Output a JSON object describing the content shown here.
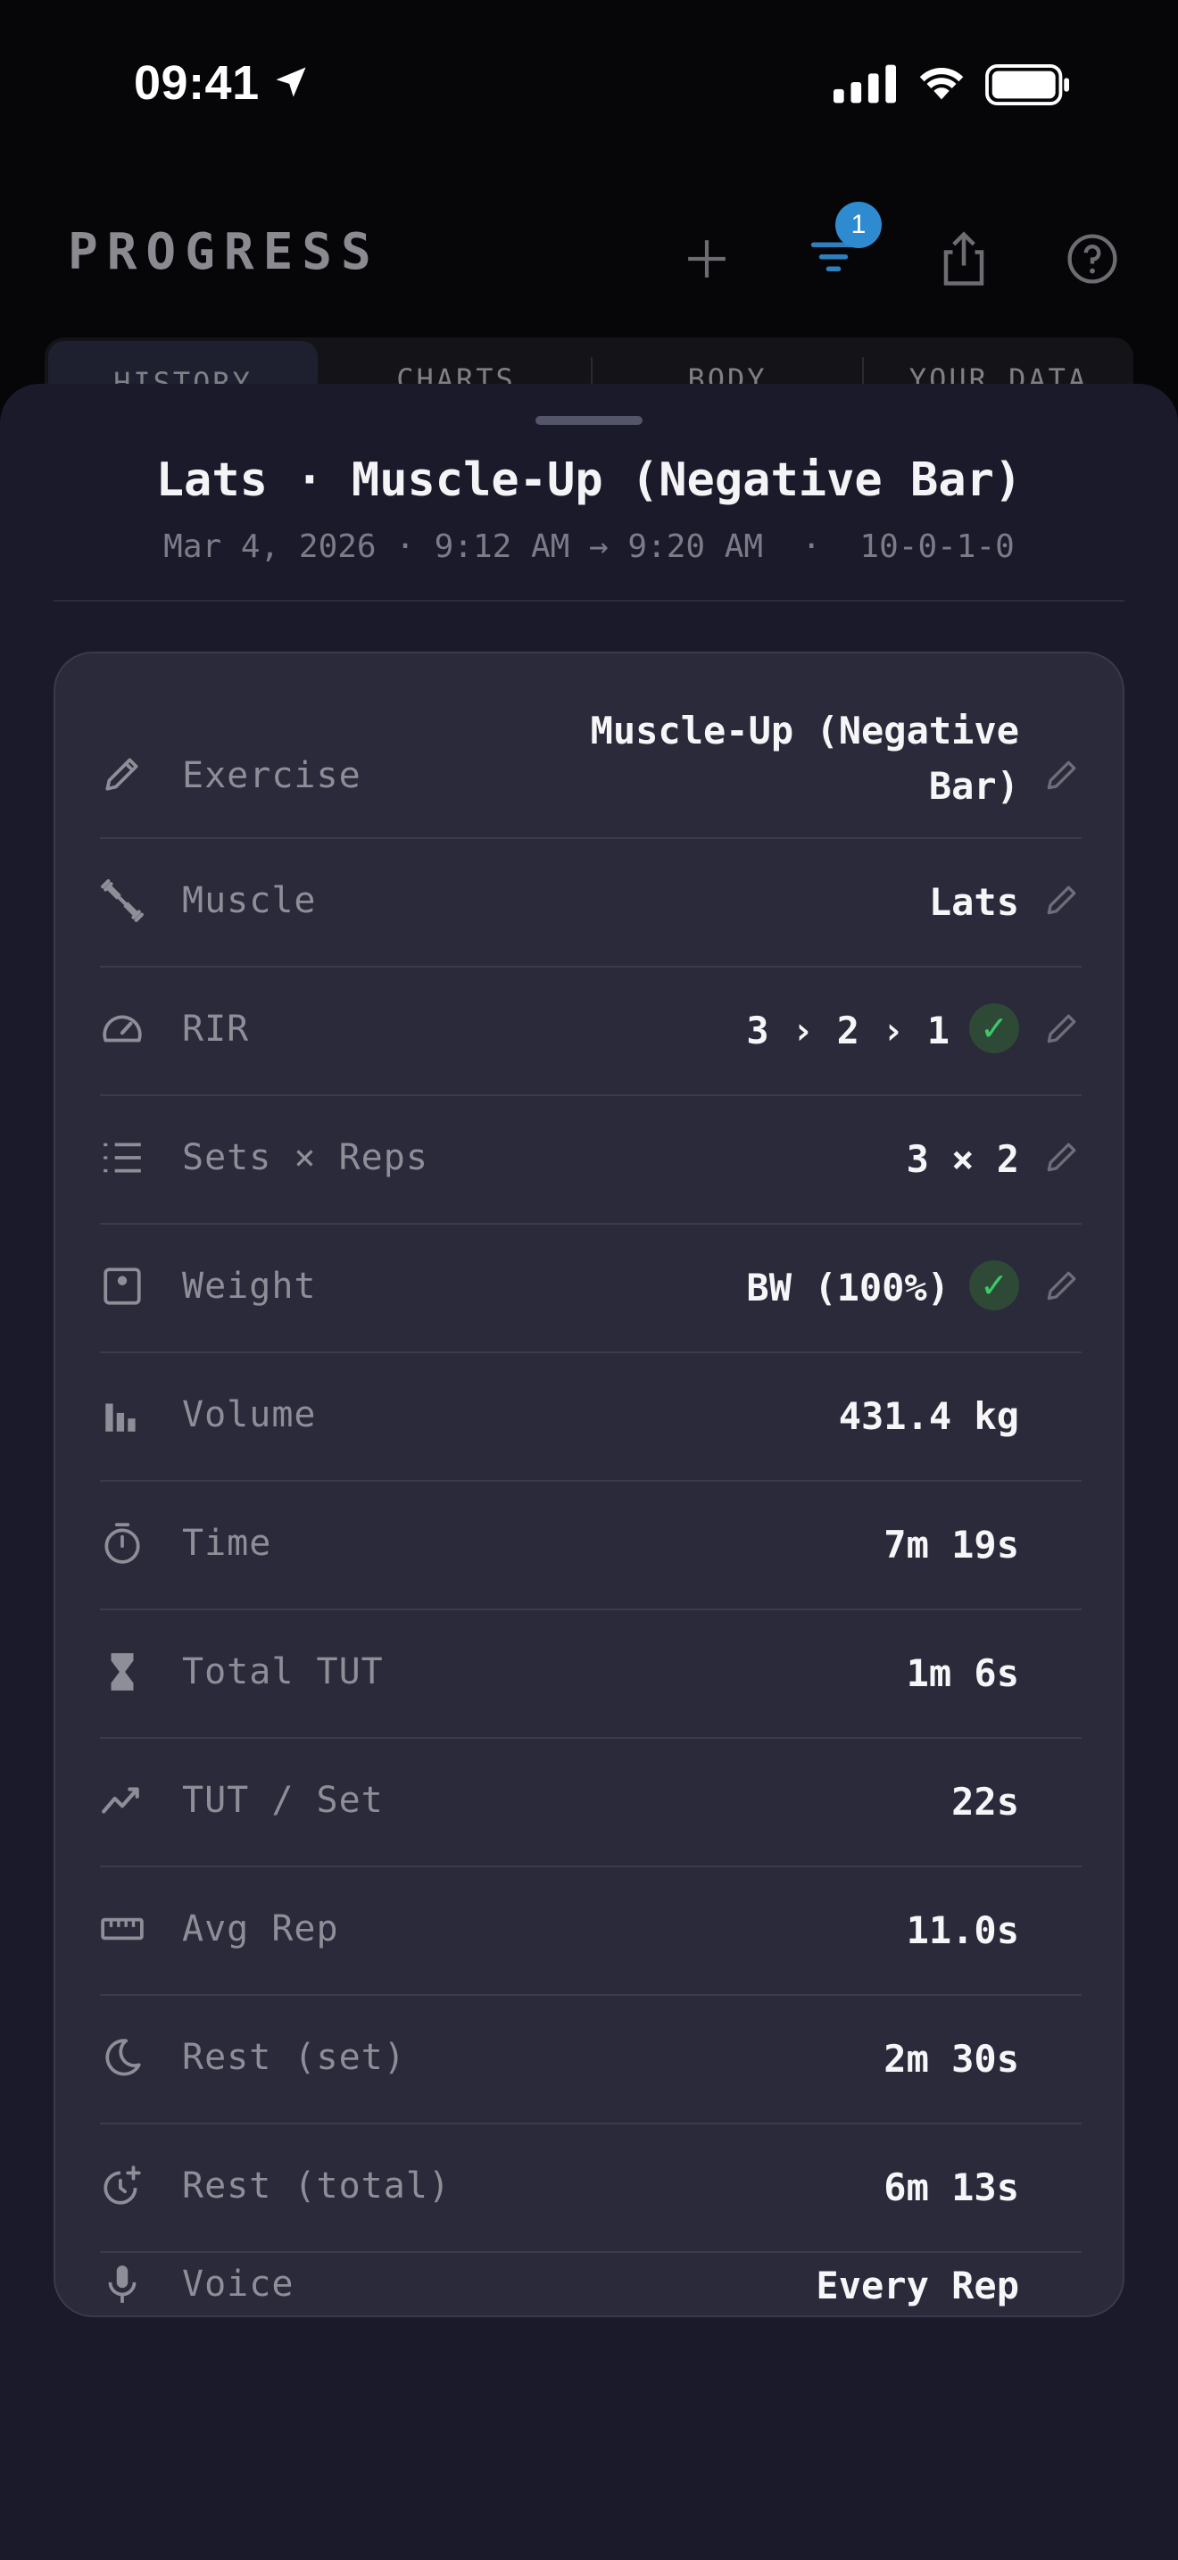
{
  "status_bar": {
    "time": "09:41"
  },
  "header": {
    "title": "PROGRESS",
    "filter_badge": "1",
    "icons": [
      "plus-icon",
      "filter-icon",
      "share-icon",
      "help-icon"
    ]
  },
  "tabs": [
    "HISTORY",
    "CHARTS",
    "BODY",
    "YOUR DATA"
  ],
  "sheet": {
    "title": "Lats · Muscle-Up (Negative Bar)",
    "subtitle": "Mar 4, 2026 · 9:12 AM → 9:20 AM  ·  10-0-1-0",
    "rows": [
      {
        "icon": "pencil-icon",
        "label": "Exercise",
        "value": "Muscle-Up (Negative\nBar)",
        "editable": true,
        "check": false
      },
      {
        "icon": "dumbbell-icon",
        "label": "Muscle",
        "value": "Lats",
        "editable": true,
        "check": false
      },
      {
        "icon": "gauge-icon",
        "label": "RIR",
        "value": "3 › 2 › 1",
        "editable": true,
        "check": true
      },
      {
        "icon": "list-icon",
        "label": "Sets × Reps",
        "value": "3 × 2",
        "editable": true,
        "check": false
      },
      {
        "icon": "scale-icon",
        "label": "Weight",
        "value": "BW (100%)",
        "editable": true,
        "check": true
      },
      {
        "icon": "bar-chart-icon",
        "label": "Volume",
        "value": "431.4 kg",
        "editable": false,
        "check": false
      },
      {
        "icon": "stopwatch-icon",
        "label": "Time",
        "value": "7m 19s",
        "editable": false,
        "check": false
      },
      {
        "icon": "hourglass-icon",
        "label": "Total TUT",
        "value": "1m 6s",
        "editable": false,
        "check": false
      },
      {
        "icon": "trend-icon",
        "label": "TUT / Set",
        "value": "22s",
        "editable": false,
        "check": false
      },
      {
        "icon": "ruler-icon",
        "label": "Avg Rep",
        "value": "11.0s",
        "editable": false,
        "check": false
      },
      {
        "icon": "moon-icon",
        "label": "Rest (set)",
        "value": "2m 30s",
        "editable": false,
        "check": false
      },
      {
        "icon": "clock-plus-icon",
        "label": "Rest (total)",
        "value": "6m 13s",
        "editable": false,
        "check": false
      },
      {
        "icon": "microphone-icon",
        "label": "Voice",
        "value": "Every Rep",
        "editable": false,
        "check": false
      }
    ],
    "check_symbol": "✓"
  },
  "colors": {
    "accent": "#2f8bd0",
    "check_green": "#3ec76a",
    "sheet_bg": "#1a1a2b",
    "card_bg": "#2a2a3b"
  }
}
